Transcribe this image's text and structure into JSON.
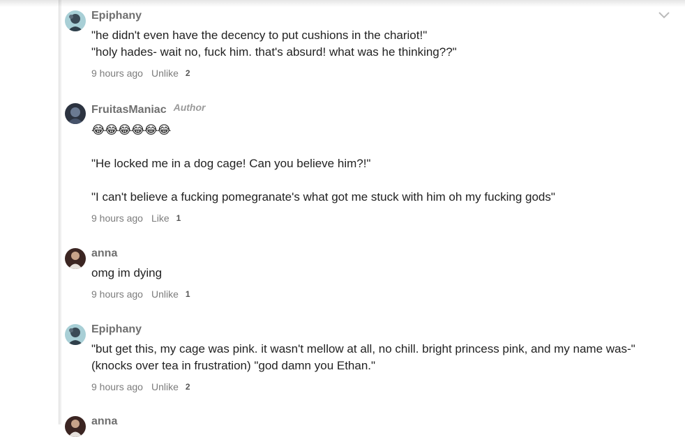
{
  "comments": [
    {
      "username": "Epiphany",
      "lines": [
        "\"he didn't even have the decency to put cushions in the chariot!\"",
        "\"holy hades- wait no, fuck him. that's absurd! what was he thinking??\""
      ],
      "time": "9 hours ago",
      "like_label": "Unlike",
      "like_count": "2"
    },
    {
      "username": "FruitasManiac",
      "author_tag": "Author",
      "emoji": "😂😂😂😂😂😂",
      "lines": [
        "\"He locked me in a dog cage! Can you believe him?!\"",
        "\"I can't believe a fucking pomegranate's what got me stuck with him oh my fucking gods\""
      ],
      "time": "9 hours ago",
      "like_label": "Like",
      "like_count": "1"
    },
    {
      "username": "anna",
      "lines": [
        "omg im dying"
      ],
      "time": "9 hours ago",
      "like_label": "Unlike",
      "like_count": "1"
    },
    {
      "username": "Epiphany",
      "lines": [
        "\"but get this, my cage was pink. it wasn't mellow at all, no chill. bright princess pink, and my name was-\"",
        "(knocks over tea in frustration) \"god damn you Ethan.\""
      ],
      "time": "9 hours ago",
      "like_label": "Unlike",
      "like_count": "2"
    },
    {
      "username": "anna"
    }
  ],
  "icons": {
    "collapse": "chevron-down-icon"
  },
  "colors": {
    "username": "#6f6f6f",
    "meta": "#7c7c7c",
    "text": "#222222"
  }
}
